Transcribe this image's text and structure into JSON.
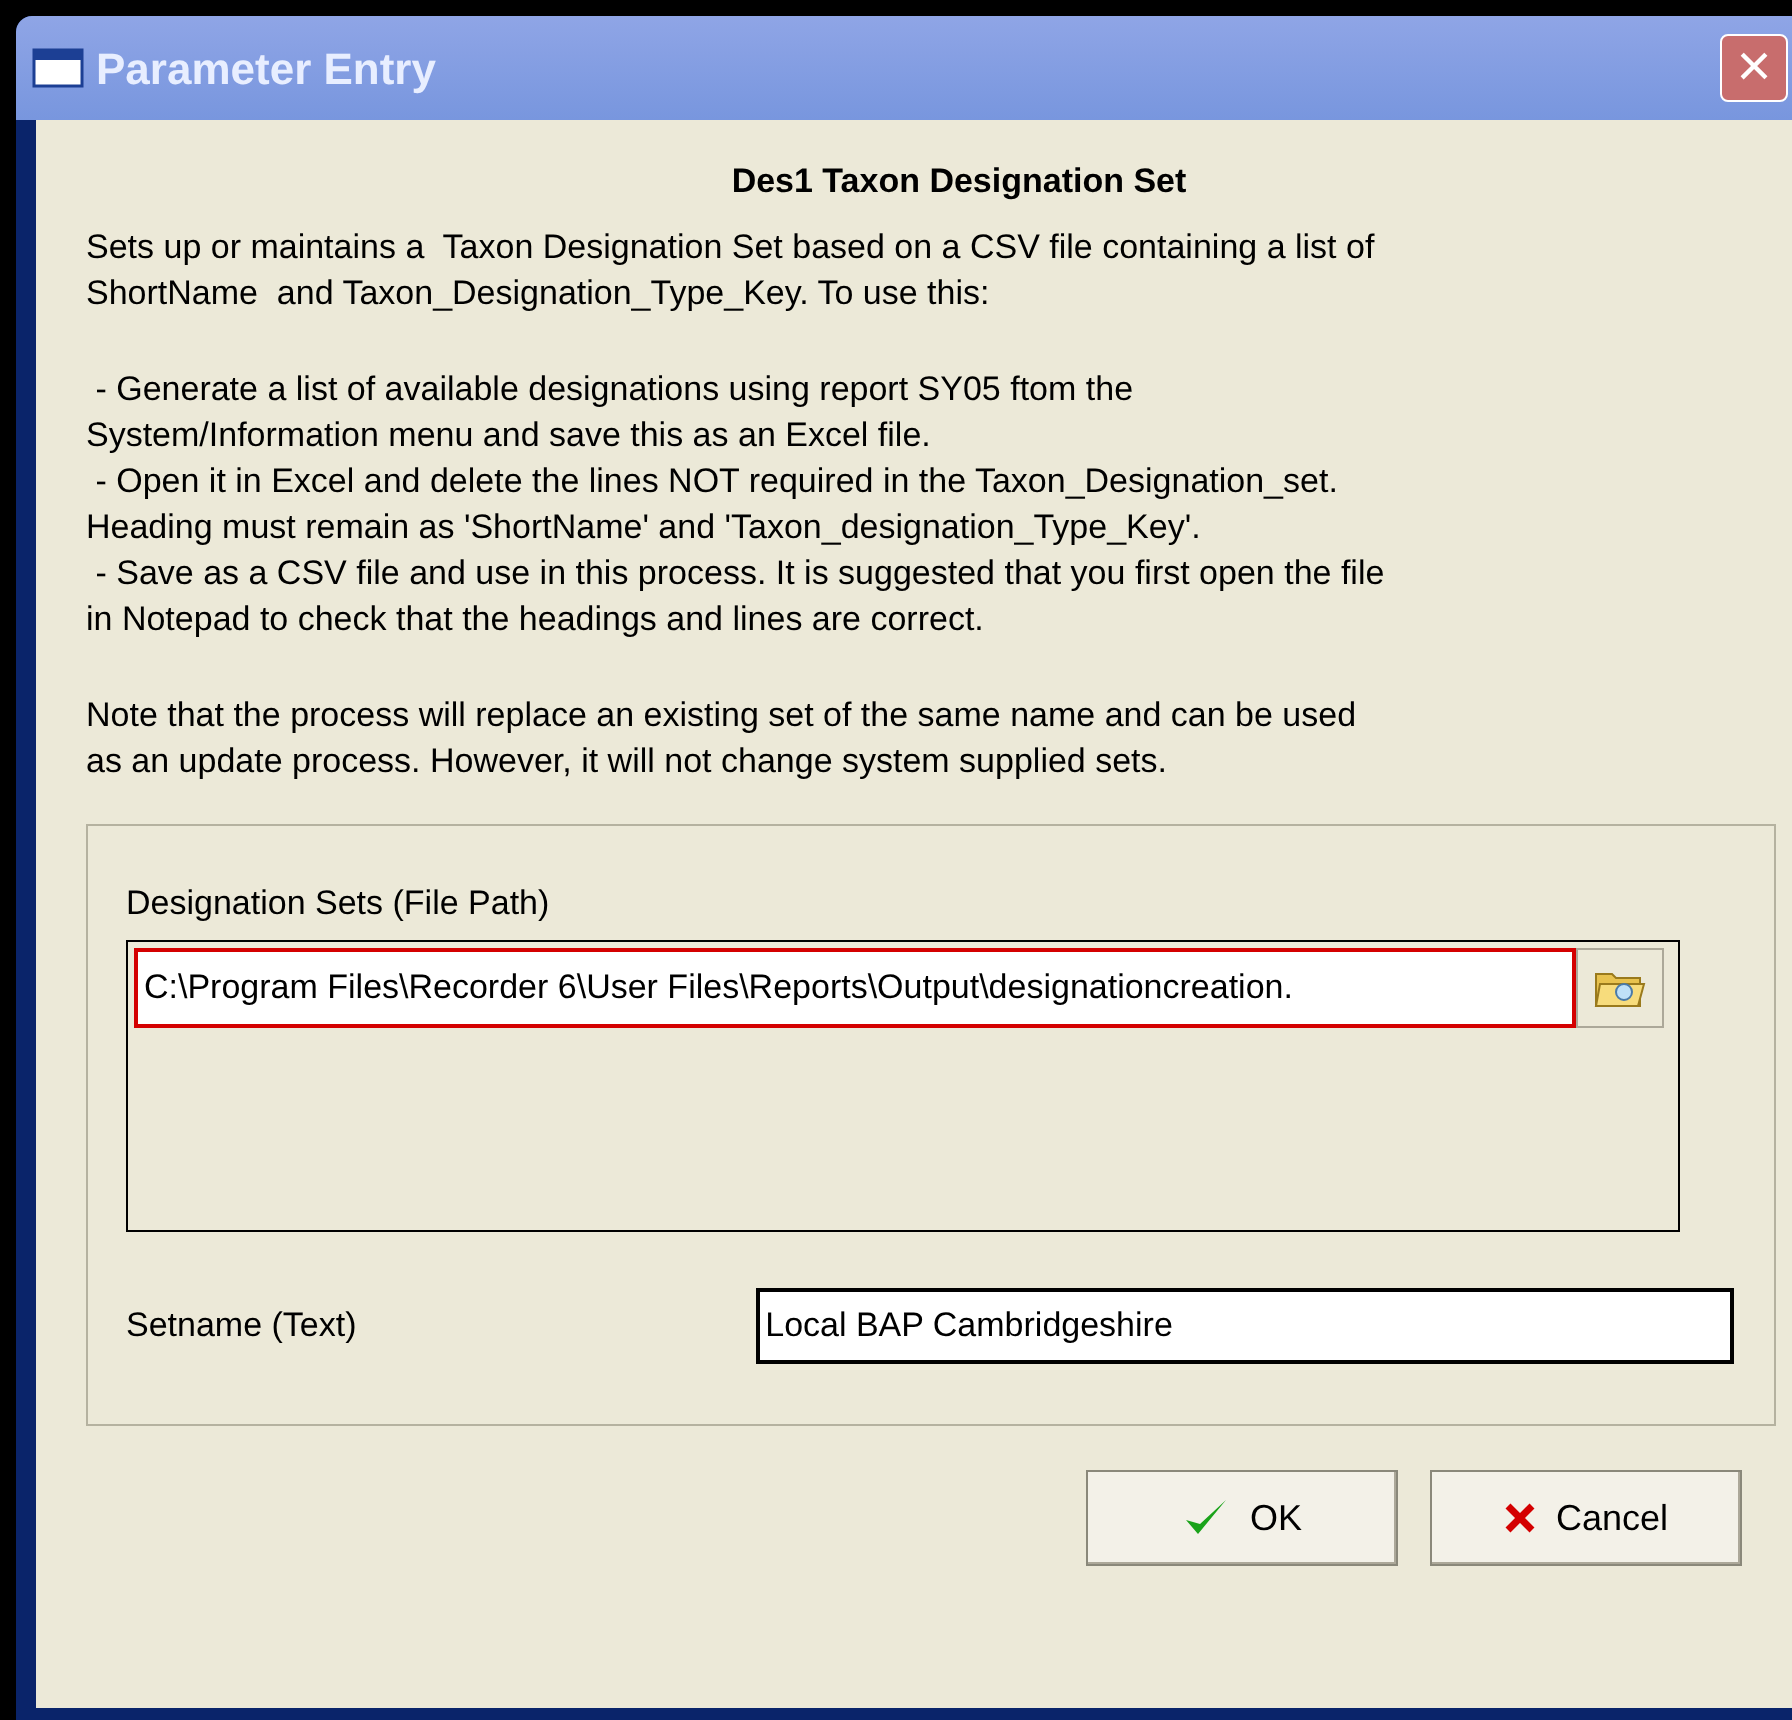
{
  "window": {
    "title": "Parameter Entry",
    "close": "×"
  },
  "heading": "Des1 Taxon Designation Set",
  "paragraphs": [
    {
      "lines": [
        "Sets up or maintains a  Taxon Designation Set based on a CSV file containing a list of",
        "ShortName  and Taxon_Designation_Type_Key. To use this:"
      ]
    },
    {
      "lines": [
        " - Generate a list of available designations using report SY05 ftom the",
        "System/Information menu and save this as an Excel file.",
        " - Open it in Excel and delete the lines NOT required in the Taxon_Designation_set.",
        "Heading must remain as 'ShortName' and 'Taxon_designation_Type_Key'.",
        " - Save as a CSV file and use in this process. It is suggested that you first open the file",
        "in Notepad to check that the headings and lines are correct."
      ]
    },
    {
      "lines": [
        "Note that the process will replace an existing set of the same name and can be used",
        "as an update process. However, it will not change system supplied sets."
      ]
    }
  ],
  "file_path": {
    "label": "Designation Sets (File Path)",
    "value": "C:\\Program Files\\Recorder 6\\User Files\\Reports\\Output\\designationcreation."
  },
  "setname": {
    "label": "Setname (Text)",
    "value": "Local BAP Cambridgeshire"
  },
  "buttons": [
    {
      "kind": "ok",
      "label": "OK"
    },
    {
      "kind": "cancel",
      "label": "Cancel"
    }
  ]
}
